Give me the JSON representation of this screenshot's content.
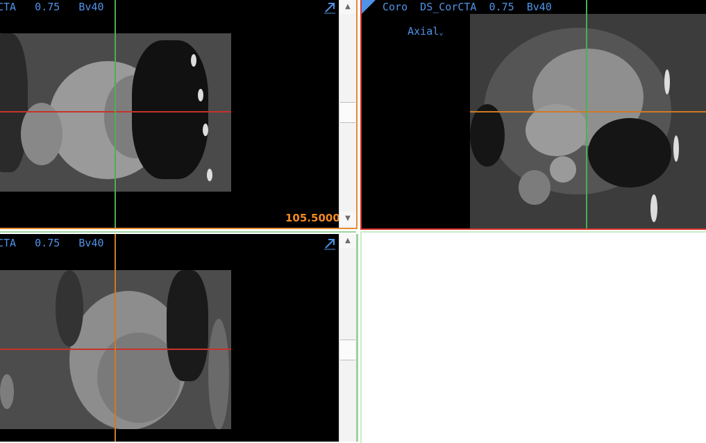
{
  "viewports": {
    "top_left": {
      "series_label": "CTA   0.75   Bv40",
      "slice_position": "105.5000"
    },
    "top_right": {
      "series_label": "Coro  DS_CorCTA  0.75  Bv40",
      "orientation_label": "Axial",
      "orientation_caret": "⌄"
    },
    "bottom_left": {
      "series_label": "CTA   0.75   Bv40"
    },
    "bottom_right": {}
  },
  "icons": {
    "maximize": "maximize-icon",
    "scroll_up": "▲",
    "scroll_down": "▼"
  },
  "colors": {
    "active_border": "#e68a2e",
    "axial_border": "#d8322a",
    "crosshair_red": "#c8322a",
    "crosshair_green": "#4bb050",
    "crosshair_orange": "#d07a25",
    "label_blue": "#4f93e8"
  }
}
